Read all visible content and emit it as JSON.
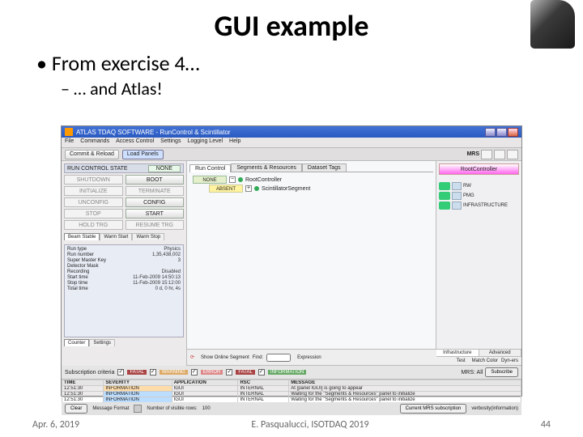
{
  "slide": {
    "title": "GUI example",
    "bullet1": "From exercise 4…",
    "bullet2": "… and Atlas!",
    "footer_left": "Apr. 6, 2019",
    "footer_mid": "E. Pasqualucci, ISOTDAQ 2019",
    "footer_right": "44"
  },
  "app": {
    "window_title": "ATLAS TDAQ SOFTWARE - RunControl & Scintillator",
    "menu": [
      "File",
      "Commands",
      "Access Control",
      "Settings",
      "Logging Level",
      "Help"
    ],
    "toolbar": {
      "commit_reload": "Commit & Reload",
      "load_panels": "Load Panels"
    },
    "left": {
      "panel_hdr_left": "RUN CONTROL STATE",
      "panel_hdr_right": "NONE",
      "rows": [
        {
          "l": "SHUTDOWN",
          "r": "BOOT"
        },
        {
          "l": "INITIALIZE",
          "r": "TERMINATE"
        },
        {
          "l": "UNCONFIG",
          "r": "CONFIG"
        },
        {
          "l": "STOP",
          "r": "START"
        },
        {
          "l": "HOLD TRG",
          "r": "RESUME TRG"
        }
      ],
      "tabs": [
        "Beam Stable",
        "Warm Start",
        "Warm Stop"
      ],
      "params": [
        {
          "k": "Run type",
          "v": "Physics"
        },
        {
          "k": "Run number",
          "v": "1,35,438,002"
        },
        {
          "k": "Super Master Key",
          "v": "3"
        },
        {
          "k": "Detector Mask",
          "v": ""
        },
        {
          "k": "Recording",
          "v": "Disabled"
        },
        {
          "k": "Start time",
          "v": "11-Feb-2009 14:50:13"
        },
        {
          "k": "Stop time",
          "v": "11-Feb-2009 15:12:00"
        },
        {
          "k": "Total time",
          "v": "0 d, 0 hr, 4s"
        }
      ],
      "bottom_tabs": [
        "Counter",
        "Settings"
      ]
    },
    "mid": {
      "tabs": [
        "Run Control",
        "Segments & Resources",
        "Dataset Tags"
      ],
      "tree": [
        {
          "state": "NONE",
          "cls": "",
          "name": "RootController",
          "pm": "-"
        },
        {
          "state": "ABSENT",
          "cls": "yellow",
          "name": "ScintillatorSegment",
          "pm": "+"
        }
      ],
      "foot": {
        "cb": "Show Online Segment",
        "find": "Find:",
        "expr": "Expression"
      }
    },
    "right": {
      "root_label": "RootController",
      "items": [
        {
          "label": "RW"
        },
        {
          "label": "PMG"
        },
        {
          "label": "INFRASTRUCTURE"
        }
      ],
      "tabs": [
        "Infrastructure",
        "Advanced"
      ],
      "footbtns": [
        "Test",
        "Match Color",
        "Dyn-ers"
      ]
    },
    "sub": {
      "label": "Subscription criteria",
      "checks": [
        "FATAL",
        "WARNING",
        "ERROR",
        "FATAL",
        "INFORMATION"
      ],
      "mrs": "MRS: All",
      "subbtn": "Subscribe"
    },
    "table": {
      "cols": [
        "TIME",
        "SEVERITY",
        "APPLICATION",
        "RSC",
        "MESSAGE"
      ],
      "rows": [
        {
          "t": "12:51:30",
          "s": "INFORMATION",
          "a": "IGUI",
          "r": "INTERNAL",
          "m": "At [panel IGUI] is going to appear"
        },
        {
          "t": "12:51:30",
          "s": "INFORMATION",
          "a": "IGUI",
          "r": "INTERNAL",
          "m": "Waiting for the \"Segments & Resources\" panel to initialize"
        },
        {
          "t": "12:51:30",
          "s": "INFORMATION",
          "a": "IGUI",
          "r": "INTERNAL",
          "m": "Waiting for the \"Segments & Resources\" panel to initialize"
        }
      ]
    },
    "bot": {
      "clear": "Clear",
      "msgfmt": "Message Format",
      "visrows": "Number of visible rows:",
      "visval": "100",
      "mrsbtn": "Current MRS subscription",
      "expr": "verbosity(information)"
    }
  }
}
